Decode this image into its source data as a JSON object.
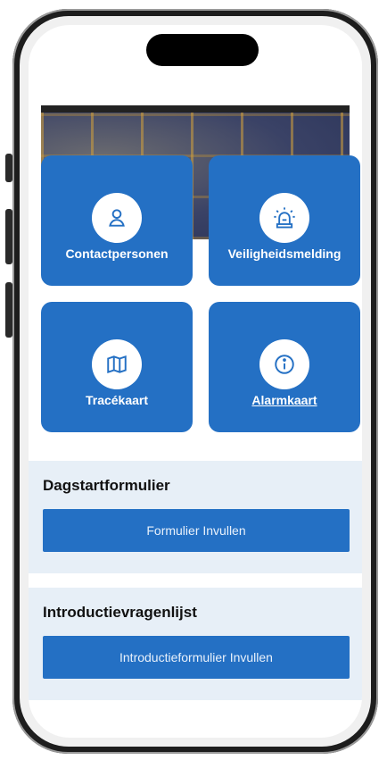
{
  "tiles": [
    {
      "label": "Contactpersonen",
      "icon": "person-icon"
    },
    {
      "label": "Veiligheidsmelding",
      "icon": "siren-icon"
    },
    {
      "label": "Tracékaart",
      "icon": "map-icon"
    },
    {
      "label": "Alarmkaart",
      "icon": "info-icon"
    }
  ],
  "sections": {
    "dagstart": {
      "title": "Dagstartformulier",
      "button": "Formulier Invullen"
    },
    "intro": {
      "title": "Introductievragenlijst",
      "button": "Introductieformulier Invullen"
    }
  },
  "colors": {
    "primary": "#2470c4",
    "section_bg": "#e7eff7"
  }
}
